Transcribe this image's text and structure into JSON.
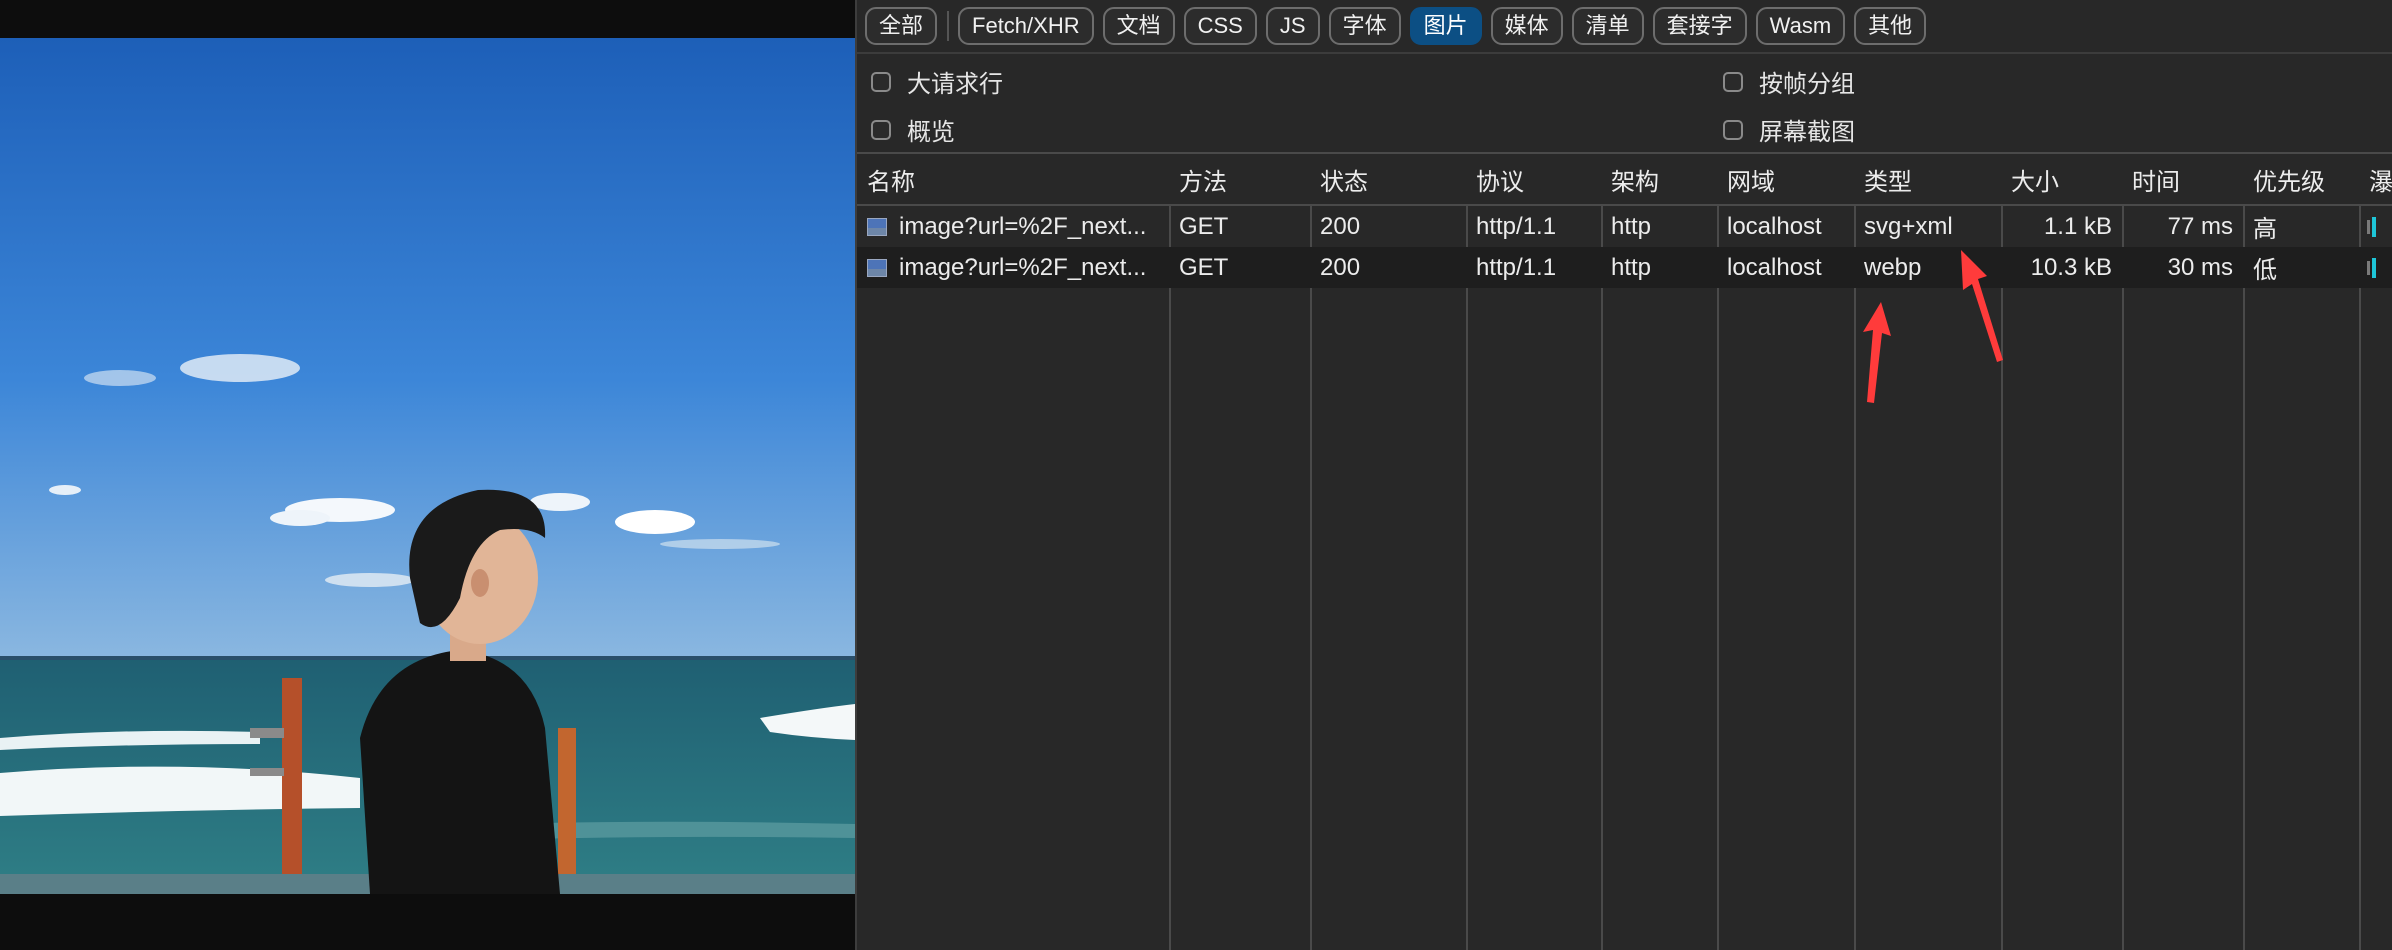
{
  "filters": [
    {
      "label": "全部",
      "active": false
    },
    {
      "label": "Fetch/XHR",
      "active": false
    },
    {
      "label": "文档",
      "active": false
    },
    {
      "label": "CSS",
      "active": false
    },
    {
      "label": "JS",
      "active": false
    },
    {
      "label": "字体",
      "active": false
    },
    {
      "label": "图片",
      "active": true
    },
    {
      "label": "媒体",
      "active": false
    },
    {
      "label": "清单",
      "active": false
    },
    {
      "label": "套接字",
      "active": false
    },
    {
      "label": "Wasm",
      "active": false
    },
    {
      "label": "其他",
      "active": false
    }
  ],
  "options": {
    "big_rows": "大请求行",
    "group_by_frame": "按帧分组",
    "overview": "概览",
    "screenshots": "屏幕截图"
  },
  "columns": {
    "name": "名称",
    "method": "方法",
    "status": "状态",
    "protocol": "协议",
    "scheme": "架构",
    "domain": "网域",
    "type": "类型",
    "size": "大小",
    "time": "时间",
    "priority": "优先级",
    "waterfall": "瀑"
  },
  "rows": [
    {
      "name": "image?url=%2F_next...",
      "method": "GET",
      "status": "200",
      "protocol": "http/1.1",
      "scheme": "http",
      "domain": "localhost",
      "type": "svg+xml",
      "size": "1.1 kB",
      "time": "77 ms",
      "priority": "高"
    },
    {
      "name": "image?url=%2F_next...",
      "method": "GET",
      "status": "200",
      "protocol": "http/1.1",
      "scheme": "http",
      "domain": "localhost",
      "type": "webp",
      "size": "10.3 kB",
      "time": "30 ms",
      "priority": "低"
    }
  ],
  "colors": {
    "active_filter": "#0c4f84",
    "annotation_arrow": "#ff3b3b",
    "waterfall_bar": "#1ec6d8"
  }
}
